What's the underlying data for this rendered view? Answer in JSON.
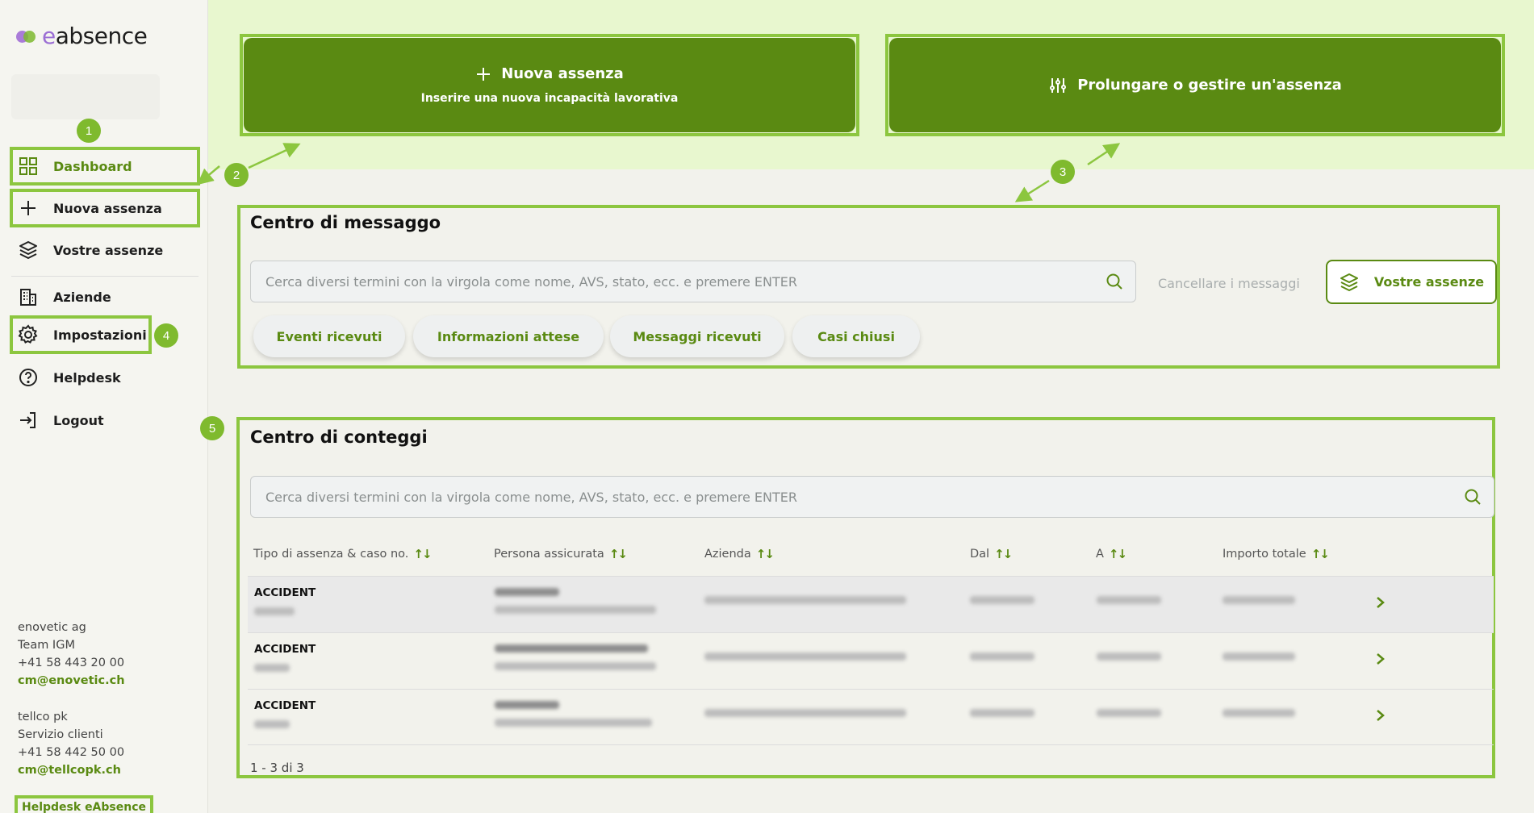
{
  "brand": {
    "logo_text_e": "e",
    "logo_text_rest": "absence"
  },
  "sidebar": {
    "items": [
      {
        "label": "Dashboard"
      },
      {
        "label": "Nuova assenza"
      },
      {
        "label": "Vostre assenze"
      },
      {
        "label": "Aziende"
      },
      {
        "label": "Impostazioni"
      },
      {
        "label": "Helpdesk"
      },
      {
        "label": "Logout"
      }
    ],
    "contacts": [
      {
        "company": "enovetic ag",
        "team": "Team IGM",
        "phone": "+41 58 443 20 00",
        "email": "cm@enovetic.ch"
      },
      {
        "company": "tellco pk",
        "team": "Servizio clienti",
        "phone": "+41 58 442 50 00",
        "email": "cm@tellcopk.ch"
      }
    ],
    "helpdesk_link": "Helpdesk eAbsence"
  },
  "badges": [
    "1",
    "2",
    "3",
    "4",
    "5"
  ],
  "actions": {
    "new_absence": {
      "label": "Nuova assenza",
      "sub": "Inserire una nuova incapacità lavorativa"
    },
    "manage_absence": {
      "label": "Prolungare o gestire un'assenza"
    }
  },
  "message_center": {
    "title": "Centro di messaggo",
    "search_placeholder": "Cerca diversi termini con la virgola come nome, AVS, stato, ecc. e premere ENTER",
    "clear_label": "Cancellare i messaggi",
    "your_absences_label": "Vostre assenze",
    "filters": [
      "Eventi ricevuti",
      "Informazioni attese",
      "Messaggi ricevuti",
      "Casi chiusi"
    ]
  },
  "counts_center": {
    "title": "Centro di conteggi",
    "search_placeholder": "Cerca diversi termini con la virgola come nome, AVS, stato, ecc. e premere ENTER",
    "columns": [
      "Tipo di assenza & caso no.",
      "Persona assicurata",
      "Azienda",
      "Dal",
      "A",
      "Importo totale"
    ],
    "sort_icon": "↑↓",
    "rows": [
      {
        "type": "ACCIDENT"
      },
      {
        "type": "ACCIDENT"
      },
      {
        "type": "ACCIDENT"
      }
    ],
    "pagination": "1 - 3 di 3"
  },
  "colors": {
    "primary": "#5a8a12",
    "highlight": "#8cc63f",
    "band": "#e8f7cf",
    "badge": "#7fba2e"
  }
}
